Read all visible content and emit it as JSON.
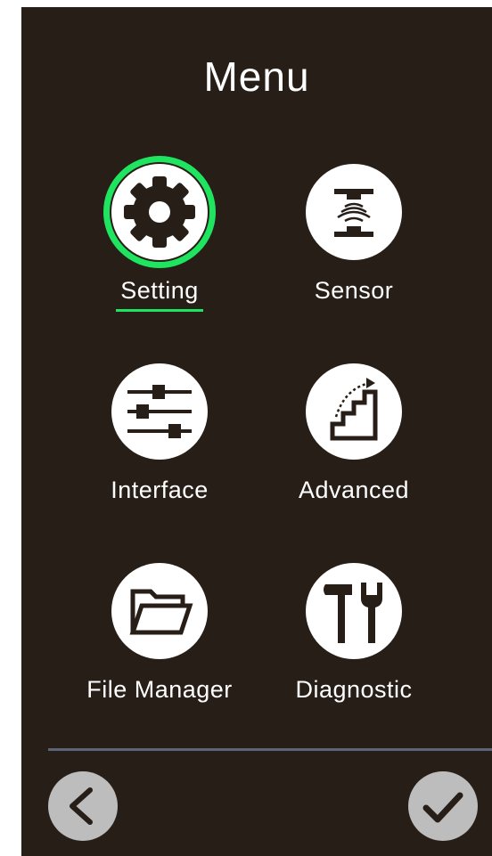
{
  "title": "Menu",
  "menu": {
    "items": [
      {
        "label": "Setting",
        "icon": "gear-icon",
        "selected": true
      },
      {
        "label": "Sensor",
        "icon": "sensor-icon",
        "selected": false
      },
      {
        "label": "Interface",
        "icon": "sliders-icon",
        "selected": false
      },
      {
        "label": "Advanced",
        "icon": "stairs-icon",
        "selected": false
      },
      {
        "label": "File Manager",
        "icon": "folder-icon",
        "selected": false
      },
      {
        "label": "Diagnostic",
        "icon": "tools-icon",
        "selected": false
      }
    ]
  },
  "nav": {
    "back_icon": "chevron-left-icon",
    "confirm_icon": "checkmark-icon"
  },
  "colors": {
    "background": "#271e17",
    "selection": "#1fe460",
    "divider": "#5e6478",
    "nav_button": "#bdbdbd"
  }
}
